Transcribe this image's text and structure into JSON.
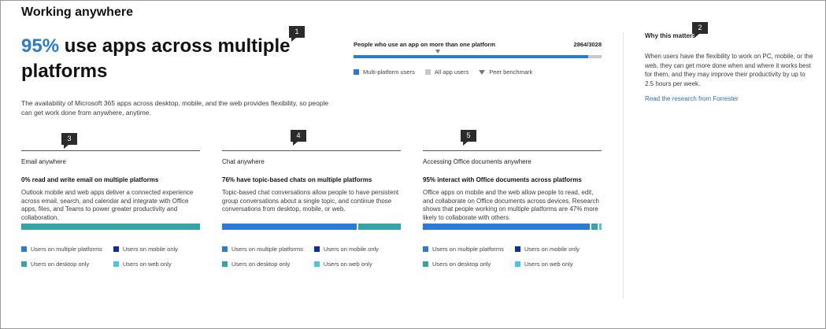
{
  "page": {
    "title": "Working anywhere"
  },
  "headline": {
    "percent": "95%",
    "text": " use apps across multiple platforms",
    "intro": "The availability of Microsoft 365 apps across desktop, mobile, and the web provides flexibility, so people can get work done from anywhere, anytime."
  },
  "markers": [
    "1",
    "2",
    "3",
    "4",
    "5"
  ],
  "top_chart": {
    "label": "People who use an app on more than one platform",
    "count": "2864/3028",
    "fill_fraction": 0.946,
    "benchmark_fraction": 0.34,
    "legend": [
      {
        "label": "Multi-platform users",
        "color": "#2b7bd4",
        "icon": "square"
      },
      {
        "label": "All app users",
        "color": "#c8c8c8",
        "icon": "square"
      },
      {
        "label": "Peer benchmark",
        "color": "#7a7a7a",
        "icon": "triangle-down"
      }
    ]
  },
  "side": {
    "title": "Why this matters",
    "text": "When users have the flexibility to work on PC, mobile, or the web, they can get more done when and where it works best for them, and they may improve their productivity by up to 2.5 hours per week.",
    "link": "Read the research from Forrester"
  },
  "colors": {
    "multiple": "#2b7bd4",
    "mobile": "#0a2fa3",
    "desktop": "#36a3a6",
    "web": "#4cc4e8"
  },
  "legend_labels": {
    "multiple": "Users on multiple platforms",
    "mobile": "Users on mobile only",
    "desktop": "Users on desktop only",
    "web": "Users on web only"
  },
  "cards": [
    {
      "title": "Email anywhere",
      "headline": "0% read and write email on multiple platforms",
      "desc": "Outlook mobile and web apps deliver a connected experience across email, search, and calendar and integrate with Office apps, files, and Teams to power greater productivity and collaboration.",
      "segments": [
        {
          "key": "desktop",
          "fraction": 1.0
        }
      ]
    },
    {
      "title": "Chat anywhere",
      "headline": "76% have topic-based chats on multiple platforms",
      "desc": "Topic-based chat conversations allow people to have persistent group conversations about a single topic, and continue those conversations from desktop, mobile, or web.",
      "segments": [
        {
          "key": "multiple",
          "fraction": 0.76
        },
        {
          "key": "desktop",
          "fraction": 0.24
        }
      ]
    },
    {
      "title": "Accessing Office documents anywhere",
      "headline": "95% interact with Office documents across platforms",
      "desc": "Office apps on mobile and the web allow people to read, edit, and collaborate on Office documents across devices. Research shows that people working on multiple platforms are 47% more likely to collaborate with others.",
      "segments": [
        {
          "key": "multiple",
          "fraction": 0.95
        },
        {
          "key": "desktop",
          "fraction": 0.035
        },
        {
          "key": "web",
          "fraction": 0.015
        }
      ]
    }
  ]
}
